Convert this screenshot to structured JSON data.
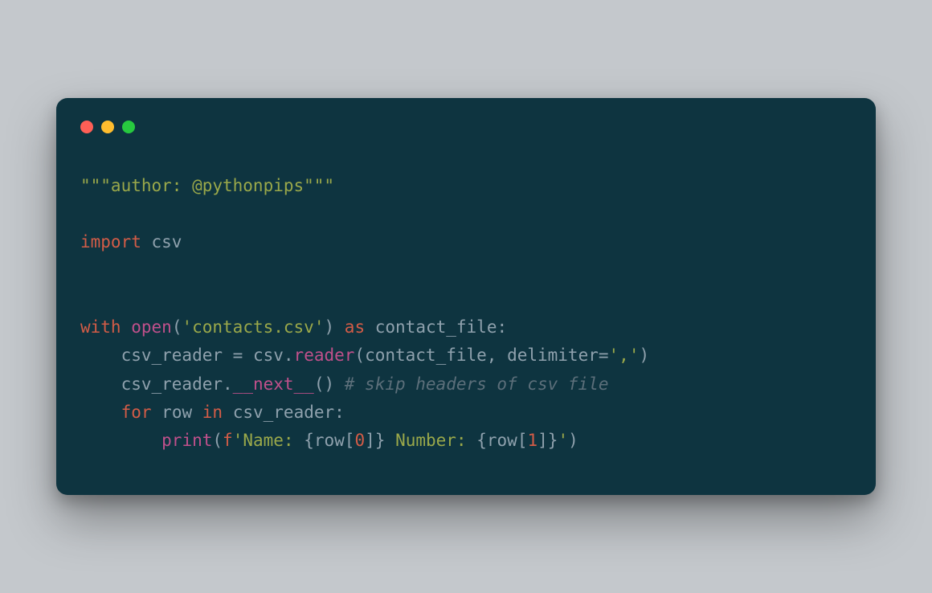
{
  "window": {
    "traffic_lights": {
      "close": "close",
      "minimize": "minimize",
      "maximize": "maximize"
    }
  },
  "code": {
    "line1": {
      "docstring": "\"\"\"author: @pythonpips\"\"\""
    },
    "line2": "",
    "line3": {
      "import_kw": "import",
      "module": " csv"
    },
    "line4": "",
    "line5": "",
    "line6": {
      "with_kw": "with",
      "sp1": " ",
      "open_fn": "open",
      "lp": "(",
      "arg_str": "'contacts.csv'",
      "rp": ")",
      "sp2": " ",
      "as_kw": "as",
      "sp3": " ",
      "var": "contact_file",
      "colon": ":"
    },
    "line7": {
      "indent": "    ",
      "lhs": "csv_reader ",
      "eq": "=",
      "sp": " csv",
      "dot": ".",
      "reader_fn": "reader",
      "lp": "(",
      "arg1": "contact_file",
      "comma": ", ",
      "kwarg": "delimiter",
      "eq2": "=",
      "val": "','",
      "rp": ")"
    },
    "line8": {
      "indent": "    ",
      "obj": "csv_reader",
      "dot": ".",
      "next_fn": "__next__",
      "parens": "() ",
      "comment": "# skip headers of csv file"
    },
    "line9": {
      "indent": "    ",
      "for_kw": "for",
      "sp1": " ",
      "var": "row",
      "sp2": " ",
      "in_kw": "in",
      "sp3": " ",
      "iter": "csv_reader",
      "colon": ":"
    },
    "line10": {
      "indent": "        ",
      "print_fn": "print",
      "lp": "(",
      "fprefix": "f",
      "q1": "'",
      "s1": "Name: ",
      "lb1": "{",
      "expr_row1": "row",
      "lbr1": "[",
      "idx0": "0",
      "rbr1": "]",
      "rb1": "}",
      "s2": " Number: ",
      "lb2": "{",
      "expr_row2": "row",
      "lbr2": "[",
      "idx1": "1",
      "rbr2": "]",
      "rb2": "}",
      "q2": "'",
      "rp": ")"
    }
  }
}
